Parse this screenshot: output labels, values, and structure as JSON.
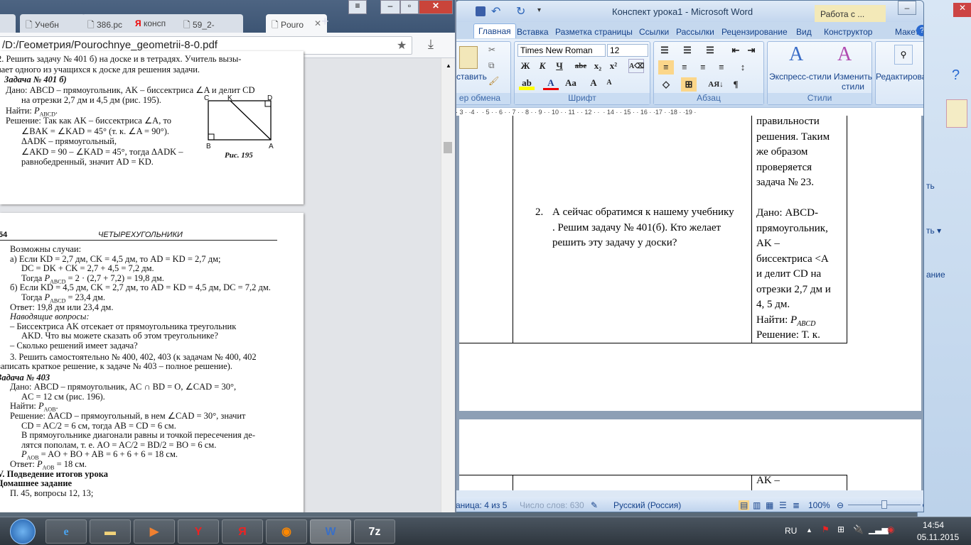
{
  "word": {
    "title": "Конспект урока1 - Microsoft Word",
    "context_tab": "Работа с ...",
    "tabs": [
      "Главная",
      "Вставка",
      "Разметка страницы",
      "Ссылки",
      "Рассылки",
      "Рецензирование",
      "Вид",
      "Конструктор",
      "Макет"
    ],
    "font_name": "Times New Roman",
    "font_size": "12",
    "groups": {
      "clipboard": "ер обмена",
      "paste": "ставить",
      "font": "Шрифт",
      "paragraph": "Абзац",
      "styles": "Стили",
      "express_styles": "Экспресс-стили",
      "change_styles": "Изменить стили",
      "editing": "Редактирование"
    },
    "font_buttons": [
      "Ж",
      "К",
      "Ч",
      "abe",
      "x₂",
      "x²",
      "Aa",
      "A",
      "A"
    ],
    "ruler": "· 3 · ·4 ·  · 5 · · 6 · · 7 · · 8 · · 9 · · 10 · · 11 · · 12 · ·  · 14 · · 15 · · 16 · ·17 · ·18 · ·19 ·",
    "doc": {
      "list_num": "2.",
      "list_text": [
        "А сейчас обратимся к нашему учебнику",
        ". Решим задачу № 401(б). Кто желает",
        "решить эту задачу у доски?"
      ],
      "right_col": [
        "правильности",
        "решения. Таким",
        "же образом",
        "проверяется",
        "задача № 23.",
        "",
        "Дано: ABCD-",
        "прямоугольник,",
        "AK –",
        "биссектриса <A",
        "и делит CD на",
        "отрезки 2,7 дм и",
        "4, 5 дм.",
        "Найти: P",
        "Решение: Т. к."
      ],
      "find_sub": "ABCD",
      "page2_text": "AK –"
    },
    "status": {
      "page": "аница: 4 из 5",
      "words": "Число слов: 630",
      "language": "Русский (Россия)",
      "zoom": "100%",
      "zoom_percent": 100
    }
  },
  "bg_window": {
    "labels": [
      "ть",
      "ть ▾",
      "ание"
    ]
  },
  "browser": {
    "tabs": [
      {
        "label": "Учебн",
        "icon": "page-icon"
      },
      {
        "label": "386.рс",
        "icon": "page-icon"
      },
      {
        "label": "консп",
        "icon": "yandex-icon"
      },
      {
        "label": "59_2-",
        "icon": "page-icon"
      },
      {
        "label": "Pouro",
        "icon": "page-icon",
        "active": true
      }
    ],
    "url": "/D:/Геометрия/Pourochnye_geometrii-8-0.pdf"
  },
  "pdf": {
    "page1": [
      "2. Решить задачу № 401 б) на доске и в тетрадях. Учитель вызы-",
      "вает одного из учащихся к доске для решения задачи.",
      "Задача № 401 б)",
      "Дано: ABCD – прямоугольник, AK – биссектриса ∠A и делит CD",
      "на отрезки 2,7 дм и 4,5 дм (рис. 195).",
      "Найти: P_ABCD.",
      "Решение: Так как AK – биссектриса ∠A, то",
      "∠BAK = ∠KAD = 45° (т. к. ∠A = 90°).",
      "ΔADK – прямоугольный,",
      "∠AKD = 90 – ∠KAD = 45°, тогда ΔADK –",
      "равнобедренный, значит AD = KD."
    ],
    "figure": {
      "labels": [
        "C",
        "K",
        "D",
        "B",
        "A"
      ],
      "caption": "Рис. 195"
    },
    "page2_number": "54",
    "page2_header": "ЧЕТЫРЕХУГОЛЬНИКИ",
    "page2": [
      "Возможны случаи:",
      "а) Если KD = 2,7 дм, CK = 4,5 дм, то AD = KD = 2,7 дм;",
      "DC = DK + CK = 2,7 + 4,5 = 7,2 дм.",
      "Тогда P_ABCD = 2 · (2,7 + 7,2) = 19,8 дм.",
      "б) Если KD = 4,5 дм, CK = 2,7 дм, то AD = KD = 4,5 дм, DC = 7,2 дм.",
      "Тогда P_ABCD = 23,4 дм.",
      "Ответ: 19,8 дм или 23,4 дм.",
      "Наводящие вопросы:",
      "– Биссектриса AK отсекает от прямоугольника треугольник",
      "AKD. Что вы можете сказать об этом треугольнике?",
      "– Сколько решений имеет задача?",
      "3. Решить самостоятельно № 400, 402, 403 (к задачам № 400, 402",
      "записать краткое решение, к задаче № 403 – полное решение).",
      "Задача № 403",
      "Дано: ABCD – прямоугольник, AC ∩ BD = O, ∠CAD = 30°,",
      "AC = 12 см (рис. 196).",
      "Найти: P_AOB.",
      "Решение: ΔACD – прямоугольный, в нем ∠CAD = 30°, значит",
      "CD = AC/2 = 6 см, тогда AB = CD = 6 см.",
      "В прямоугольнике диагонали равны и точкой пересечения де-",
      "лятся пополам, т. е. AO = AC/2 = BD/2 = BO = 6 см.",
      "P_AOB = AO + BO + AB = 6 + 6 + 6 = 18 см.",
      "Ответ: P_AOB = 18 см.",
      "V. Подведение итогов урока",
      "Домашнее задание",
      "П. 45, вопросы 12, 13;"
    ]
  },
  "taskbar": {
    "apps": [
      "start",
      "ie",
      "explorer",
      "media",
      "yandex",
      "yandex-search",
      "firefox",
      "word",
      "7zip"
    ],
    "lang": "RU",
    "time": "14:54",
    "date": "05.11.2015",
    "seven_zip": "7z",
    "yandex": "Я"
  }
}
